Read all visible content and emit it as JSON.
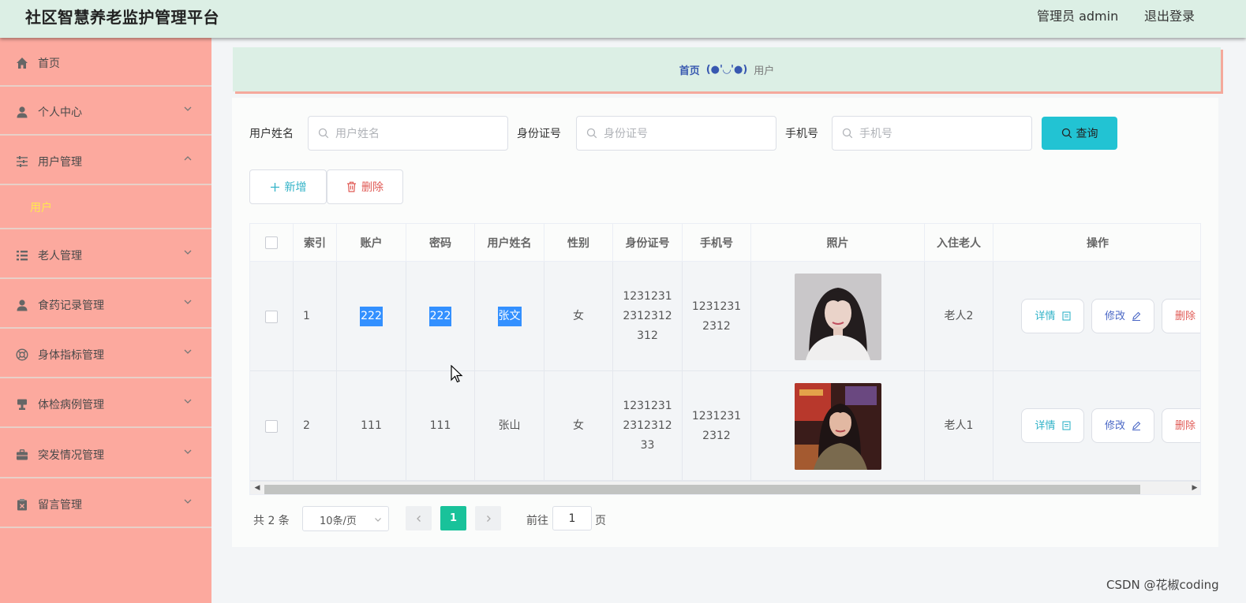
{
  "header": {
    "title": "社区智慧养老监护管理平台",
    "admin": "管理员 admin",
    "logout": "退出登录"
  },
  "sidebar": {
    "items": [
      {
        "label": "首页",
        "icon": "home-icon"
      },
      {
        "label": "个人中心",
        "icon": "person-icon"
      },
      {
        "label": "用户管理",
        "icon": "sliders-icon",
        "expanded": true,
        "sub": [
          "用户"
        ]
      },
      {
        "label": "老人管理",
        "icon": "list-icon"
      },
      {
        "label": "食药记录管理",
        "icon": "person-icon"
      },
      {
        "label": "身体指标管理",
        "icon": "lifebuoy-icon"
      },
      {
        "label": "体检病例管理",
        "icon": "stamp-icon"
      },
      {
        "label": "突发情况管理",
        "icon": "briefcase-icon"
      },
      {
        "label": "留言管理",
        "icon": "clipboard-icon"
      }
    ]
  },
  "breadcrumb": {
    "home": "首页",
    "separator": "(●'◡'●)",
    "current": "用户"
  },
  "search": {
    "fields": [
      {
        "label": "用户姓名",
        "placeholder": "用户姓名"
      },
      {
        "label": "身份证号",
        "placeholder": "身份证号"
      },
      {
        "label": "手机号",
        "placeholder": "手机号"
      }
    ],
    "button": "查询"
  },
  "actions": {
    "add": "新增",
    "delete": "删除"
  },
  "table": {
    "headers": [
      "索引",
      "账户",
      "密码",
      "用户姓名",
      "性别",
      "身份证号",
      "手机号",
      "照片",
      "入住老人",
      "操作"
    ],
    "rows": [
      {
        "index": "1",
        "account": "222",
        "password": "222",
        "name": "张文",
        "gender": "女",
        "id_card": "12312312312312312",
        "phone": "12312312312",
        "elder": "老人2",
        "selected_text": true
      },
      {
        "index": "2",
        "account": "111",
        "password": "111",
        "name": "张山",
        "gender": "女",
        "id_card": "1231231231231233",
        "phone": "12312312312",
        "elder": "老人1",
        "selected_text": false
      }
    ],
    "row_actions": {
      "detail": "详情",
      "edit": "修改",
      "delete": "删除"
    }
  },
  "pagination": {
    "total": "共 2 条",
    "page_size": "10条/页",
    "current_page": "1",
    "goto_prefix": "前往",
    "goto_value": "1",
    "goto_suffix": "页"
  },
  "watermark": "CSDN @花椒coding",
  "colors": {
    "header_bg": "#dcefe5",
    "sidebar_bg": "#fca99e",
    "sub_active": "#ffe94d",
    "search_btn": "#22c3d3",
    "page_active": "#19c29a",
    "selection": "#3390ff"
  }
}
